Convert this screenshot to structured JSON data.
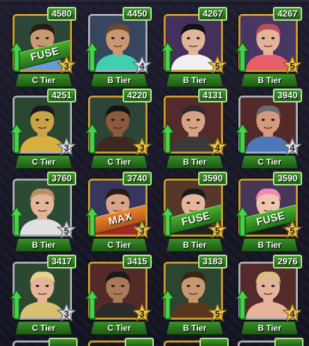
{
  "roster": {
    "cards": [
      {
        "score": "4580",
        "tier": "C Tier",
        "stars": "3",
        "banner": "FUSE",
        "banner_type": "fuse",
        "frame": "gold",
        "bg": "#1f3b2c",
        "skin": "#c89a72",
        "hair": "#2a1c12",
        "accent": "#6a9ad8",
        "star_color": "gold"
      },
      {
        "score": "4450",
        "tier": "B Tier",
        "stars": "4",
        "banner": "",
        "banner_type": "",
        "frame": "silver",
        "bg": "#2b3b55",
        "skin": "#c99873",
        "hair": "#6b4a2c",
        "accent": "#3fd0b0",
        "star_color": "silver"
      },
      {
        "score": "4267",
        "tier": "B Tier",
        "stars": "5",
        "banner": "",
        "banner_type": "",
        "frame": "gold",
        "bg": "#3a2452",
        "skin": "#e0b599",
        "hair": "#121212",
        "accent": "#f0f0f0",
        "star_color": "gold"
      },
      {
        "score": "4267",
        "tier": "B Tier",
        "stars": "5",
        "banner": "",
        "banner_type": "",
        "frame": "gold",
        "bg": "#3d2a5a",
        "skin": "#e4b39a",
        "hair": "#b84f5a",
        "accent": "#e85d6a",
        "star_color": "gold"
      },
      {
        "score": "4251",
        "tier": "C Tier",
        "stars": "3",
        "banner": "",
        "banner_type": "",
        "frame": "silver",
        "bg": "#1d3d24",
        "skin": "#c9a24a",
        "hair": "#1a1a1a",
        "accent": "#d8b040",
        "star_color": "silver"
      },
      {
        "score": "4220",
        "tier": "C Tier",
        "stars": "3",
        "banner": "",
        "banner_type": "",
        "frame": "gold",
        "bg": "#1f3a2b",
        "skin": "#8a5a3a",
        "hair": "#121212",
        "accent": "#3a2a20",
        "star_color": "gold"
      },
      {
        "score": "4131",
        "tier": "B Tier",
        "stars": "4",
        "banner": "",
        "banner_type": "",
        "frame": "gold",
        "bg": "#4a1d1d",
        "skin": "#d6a283",
        "hair": "#2a2a2a",
        "accent": "#3a3a3a",
        "star_color": "gold"
      },
      {
        "score": "3940",
        "tier": "C Tier",
        "stars": "4",
        "banner": "",
        "banner_type": "",
        "frame": "silver",
        "bg": "#4a1c1c",
        "skin": "#d49a7e",
        "hair": "#6b6b6b",
        "accent": "#4a78b8",
        "star_color": "silver"
      },
      {
        "score": "3760",
        "tier": "B Tier",
        "stars": "5",
        "banner": "",
        "banner_type": "",
        "frame": "silver",
        "bg": "#1f4029",
        "skin": "#e2b59a",
        "hair": "#b9905e",
        "accent": "#e0e0e0",
        "star_color": "silver"
      },
      {
        "score": "3740",
        "tier": "C Tier",
        "stars": "3",
        "banner": "MAX",
        "banner_type": "max",
        "frame": "gold",
        "bg": "#2b2a55",
        "skin": "#d8a487",
        "hair": "#2a1c12",
        "accent": "#a02a2a",
        "star_color": "gold"
      },
      {
        "score": "3590",
        "tier": "B Tier",
        "stars": "5",
        "banner": "FUSE",
        "banner_type": "fuse",
        "frame": "gold",
        "bg": "#4a2d1c",
        "skin": "#e3b69b",
        "hair": "#1a1a1a",
        "accent": "#222",
        "star_color": "gold"
      },
      {
        "score": "3590",
        "tier": "B Tier",
        "stars": "5",
        "banner": "FUSE",
        "banner_type": "fuse",
        "frame": "gold",
        "bg": "#3b2a4d",
        "skin": "#f0c4ad",
        "hair": "#f08ab0",
        "accent": "#1b1b1b",
        "star_color": "gold"
      },
      {
        "score": "3417",
        "tier": "C Tier",
        "stars": "3",
        "banner": "",
        "banner_type": "",
        "frame": "silver",
        "bg": "#1f3d24",
        "skin": "#e4b39a",
        "hair": "#e7d48a",
        "accent": "#d8c070",
        "star_color": "silver"
      },
      {
        "score": "3415",
        "tier": "C Tier",
        "stars": "3",
        "banner": "",
        "banner_type": "",
        "frame": "gold",
        "bg": "#4a1c1c",
        "skin": "#a87a58",
        "hair": "#1a1a1a",
        "accent": "#2a2a2a",
        "star_color": "gold"
      },
      {
        "score": "3183",
        "tier": "B Tier",
        "stars": "5",
        "banner": "",
        "banner_type": "",
        "frame": "gold",
        "bg": "#1f3a24",
        "skin": "#c89772",
        "hair": "#3a2414",
        "accent": "#5a3620",
        "star_color": "gold"
      },
      {
        "score": "2976",
        "tier": "B Tier",
        "stars": "4",
        "banner": "",
        "banner_type": "",
        "frame": "silver",
        "bg": "#4a1d1d",
        "skin": "#e4b39a",
        "hair": "#d8c080",
        "accent": "#e4b39a",
        "star_color": "gold"
      }
    ]
  }
}
